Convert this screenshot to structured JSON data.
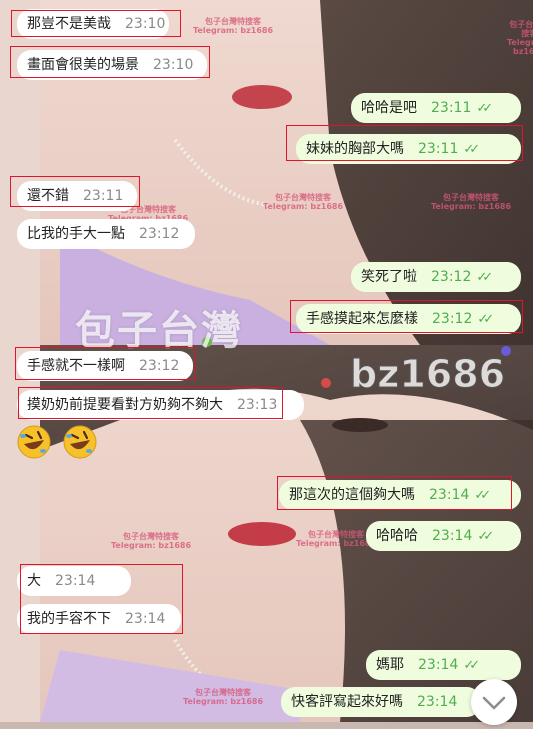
{
  "messages": [
    {
      "id": "m1",
      "dir": "in",
      "text": "那豈不是美哉",
      "time": "23:10",
      "status": ""
    },
    {
      "id": "m2",
      "dir": "in",
      "text": "畫面會很美的場景",
      "time": "23:10",
      "status": ""
    },
    {
      "id": "m3",
      "dir": "out",
      "text": "哈哈是吧",
      "time": "23:11",
      "status": "read"
    },
    {
      "id": "m4",
      "dir": "out",
      "text": "妹妹的胸部大嗎",
      "time": "23:11",
      "status": "read"
    },
    {
      "id": "m5",
      "dir": "in",
      "text": "還不錯",
      "time": "23:11",
      "status": ""
    },
    {
      "id": "m6",
      "dir": "in",
      "text": "比我的手大一點",
      "time": "23:12",
      "status": ""
    },
    {
      "id": "m7",
      "dir": "out",
      "text": "笑死了啦",
      "time": "23:12",
      "status": "read"
    },
    {
      "id": "m8",
      "dir": "out",
      "text": "手感摸起來怎麼樣",
      "time": "23:12",
      "status": "read"
    },
    {
      "id": "m9",
      "dir": "in",
      "text": "手感就不一樣啊",
      "time": "23:12",
      "status": ""
    },
    {
      "id": "m10",
      "dir": "in",
      "text": "摸奶奶前提要看對方奶夠不夠大",
      "time": "23:13",
      "status": ""
    },
    {
      "id": "m11",
      "dir": "out",
      "text": "那這次的這個夠大嗎",
      "time": "23:14",
      "status": "read"
    },
    {
      "id": "m12",
      "dir": "out",
      "text": "哈哈哈",
      "time": "23:14",
      "status": "read"
    },
    {
      "id": "m13",
      "dir": "in",
      "text": "大",
      "time": "23:14",
      "status": ""
    },
    {
      "id": "m14",
      "dir": "in",
      "text": "我的手容不下",
      "time": "23:14",
      "status": ""
    },
    {
      "id": "m15",
      "dir": "out",
      "text": "媽耶",
      "time": "23:14",
      "status": "read"
    },
    {
      "id": "m16",
      "dir": "out",
      "text": "快客評寫起來好嗎",
      "time": "23:14",
      "status": ""
    }
  ],
  "emoji_row": {
    "icon": "rolling-on-floor-laughing-emoji",
    "count": 2
  },
  "watermark": {
    "small_line1": "包子台灣特搜客",
    "small_line2": "Telegram: bz1686",
    "big_text": "包子台灣",
    "big_handle": "bz1686"
  },
  "scroll_button": {
    "icon": "chevron-down-icon"
  },
  "colors": {
    "incoming": "#ffffff",
    "outgoing": "#effdde",
    "check": "#4fae4e",
    "highlight": "#e0142b"
  }
}
